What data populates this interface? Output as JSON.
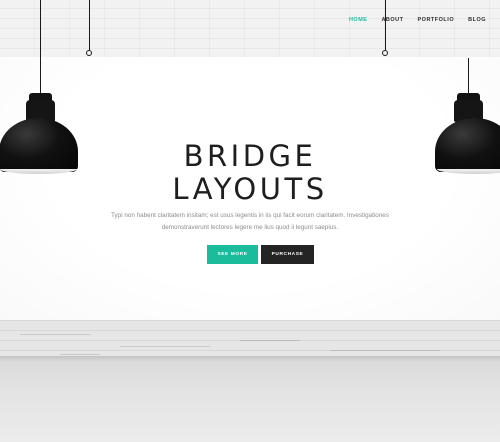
{
  "nav": {
    "items": [
      {
        "label": "HOME",
        "active": true
      },
      {
        "label": "ABOUT",
        "active": false
      },
      {
        "label": "PORTFOLIO",
        "active": false
      },
      {
        "label": "BLOG",
        "active": false
      }
    ]
  },
  "hero": {
    "title_line1": "BRIDGE",
    "title_line2": "LAYOUTS",
    "text_line1": "Typi non habent claritatem insitam; est usus legentis in iis qui facit eorum claritatem. Investigationes",
    "text_line2": "demonstraverunt lectores legere me lius quod ii legunt saepius.",
    "button_primary": "SEE MORE",
    "button_secondary": "PURCHASE"
  },
  "colors": {
    "accent": "#1abc9c",
    "dark": "#242424",
    "title": "#1e1e1e",
    "body_text": "#8c8c8c"
  },
  "icons": {
    "left_lamp": "pendant-lamp-icon",
    "right_lamp": "pendant-lamp-icon"
  }
}
